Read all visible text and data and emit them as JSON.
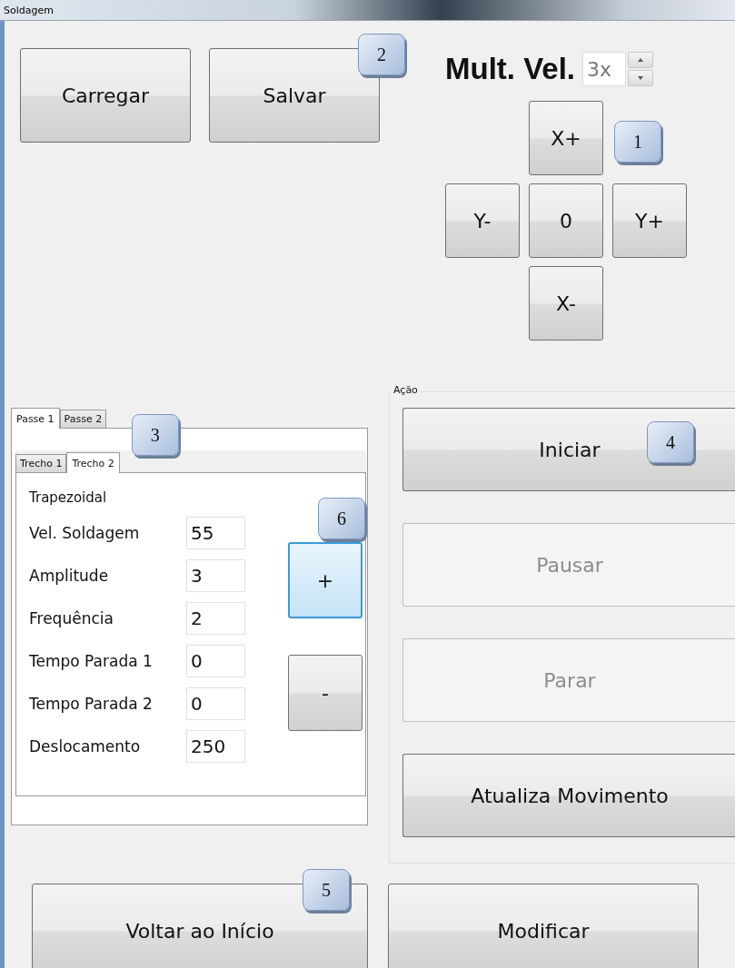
{
  "window": {
    "title": "Soldagem"
  },
  "file_buttons": [
    {
      "label": "Carregar"
    },
    {
      "label": "Salvar",
      "callout": "2"
    }
  ],
  "speed_multiplier": {
    "label": "Mult. Vel.",
    "value": "3x"
  },
  "jog_buttons": [
    {
      "label": "X+",
      "callout": "1"
    },
    {
      "label": "Y-"
    },
    {
      "label": "0"
    },
    {
      "label": "Y+"
    },
    {
      "label": "X-"
    }
  ],
  "pass_tabs": [
    {
      "label": "Passe 1",
      "selected": true
    },
    {
      "label": "Passe 2",
      "selected": false
    }
  ],
  "segment_tabs": [
    {
      "label": "Trecho 1",
      "selected": false
    },
    {
      "label": "Trecho 2",
      "selected": true,
      "callout": "3"
    }
  ],
  "segment": {
    "type_label": "Trapezoidal",
    "fields": [
      {
        "label": "Vel. Soldagem",
        "value": "55"
      },
      {
        "label": "Amplitude",
        "value": "3"
      },
      {
        "label": "Frequência",
        "value": "2"
      },
      {
        "label": "Tempo Parada 1",
        "value": "0"
      },
      {
        "label": "Tempo Parada 2",
        "value": "0"
      },
      {
        "label": "Deslocamento",
        "value": "250"
      }
    ],
    "buttons": [
      {
        "label": "+",
        "focused": true,
        "callout": "6"
      },
      {
        "label": "-",
        "focused": false
      }
    ]
  },
  "action_group": {
    "title": "Ação",
    "buttons": [
      {
        "label": "Iniciar",
        "disabled": false,
        "callout": "4"
      },
      {
        "label": "Pausar",
        "disabled": true
      },
      {
        "label": "Parar",
        "disabled": true
      },
      {
        "label": "Atualiza Movimento",
        "disabled": false
      }
    ]
  },
  "bottom_buttons": [
    {
      "label": "Voltar ao Início",
      "callout": "5"
    },
    {
      "label": "Modificar"
    }
  ]
}
